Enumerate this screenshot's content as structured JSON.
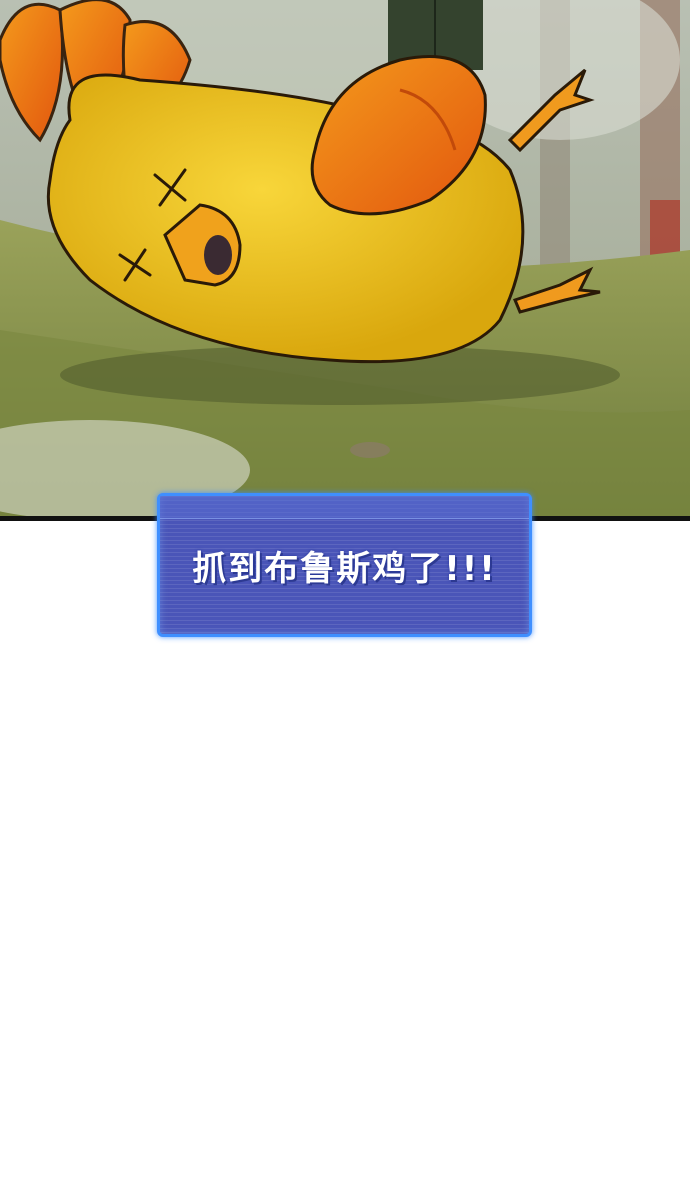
{
  "caption": {
    "text": "抓到布鲁斯鸡了!!!"
  },
  "colors": {
    "caption_bg": "#4a55b8",
    "caption_border": "#3f8fff",
    "chick_body": "#f2c21c",
    "chick_wing": "#f07a14"
  }
}
